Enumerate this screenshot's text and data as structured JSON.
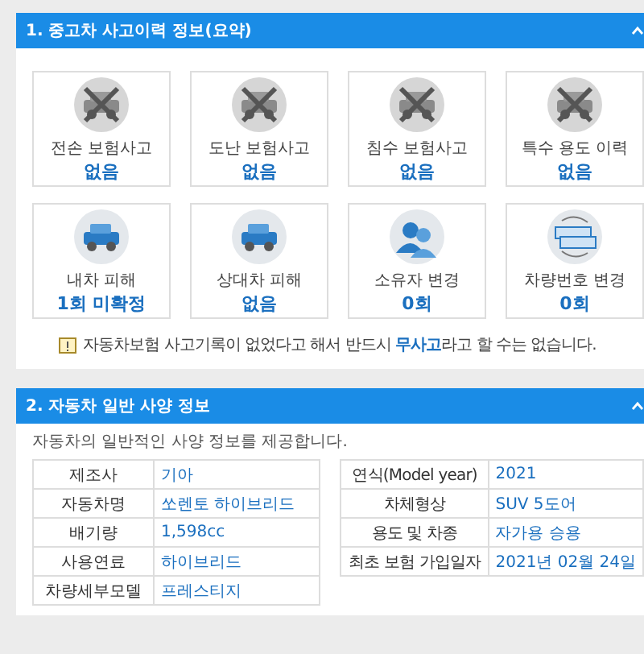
{
  "section1": {
    "title": "1. 중고차 사고이력 정보(요약)",
    "cards": [
      {
        "label": "전손 보험사고",
        "value": "없음",
        "crossed": true,
        "kind": "total-loss"
      },
      {
        "label": "도난 보험사고",
        "value": "없음",
        "crossed": true,
        "kind": "theft"
      },
      {
        "label": "침수 보험사고",
        "value": "없음",
        "crossed": true,
        "kind": "flood"
      },
      {
        "label": "특수 용도 이력",
        "value": "없음",
        "crossed": true,
        "kind": "special"
      },
      {
        "label": "내차 피해",
        "value": "1회 미확정",
        "crossed": false,
        "kind": "own-damage"
      },
      {
        "label": "상대차 피해",
        "value": "없음",
        "crossed": false,
        "kind": "other-damage"
      },
      {
        "label": "소유자 변경",
        "value": "0회",
        "crossed": false,
        "kind": "owner"
      },
      {
        "label": "차량번호 변경",
        "value": "0회",
        "crossed": false,
        "kind": "plate"
      }
    ],
    "note": "자동차보험 사고기록이 없었다고 해서 반드시 **무사고**라고 할 수는 없습니다."
  },
  "section2": {
    "title": "2. 자동차 일반 사양 정보",
    "subtitle": "자동차의 일반적인 사양 정보를 제공합니다.",
    "left": [
      {
        "label": "제조사",
        "value": "기아"
      },
      {
        "label": "자동차명",
        "value": "쏘렌토 하이브리드"
      },
      {
        "label": "배기량",
        "value": "1,598cc"
      },
      {
        "label": "사용연료",
        "value": "하이브리드"
      },
      {
        "label": "차량세부모델",
        "value": "프레스티지"
      }
    ],
    "right": [
      {
        "label": "연식(Model year)",
        "value": "2021"
      },
      {
        "label": "차체형상",
        "value": "SUV 5도어"
      },
      {
        "label": "용도 및 차종",
        "value": "자가용  승용"
      },
      {
        "label": "최초 보험 가입일자",
        "value": "2021년 02월 24일"
      }
    ]
  }
}
